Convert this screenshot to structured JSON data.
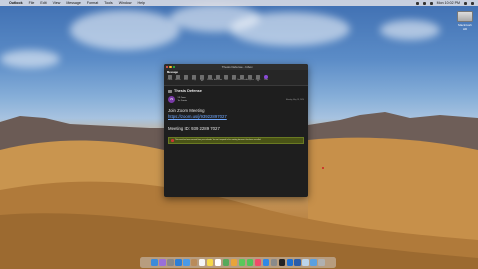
{
  "menubar": {
    "app_name": "Outlook",
    "items": [
      "File",
      "Edit",
      "View",
      "Message",
      "Format",
      "Tools",
      "Window",
      "Help"
    ],
    "clock": "Mon 10:02 PM"
  },
  "desktop": {
    "drive_label": "Macintosh HD"
  },
  "window": {
    "title": "Thesis Defense - Inbox",
    "tabs": [
      "Message"
    ],
    "ribbon": [
      {
        "label": "Delete",
        "icon": "trash-icon"
      },
      {
        "label": "Archive",
        "icon": "archive-icon"
      },
      {
        "label": "Move",
        "icon": "folder-icon"
      },
      {
        "label": "Reply",
        "icon": "reply-icon"
      },
      {
        "label": "Reply All",
        "icon": "reply-all-icon"
      },
      {
        "label": "Forward",
        "icon": "forward-icon"
      },
      {
        "label": "Attachment",
        "icon": "paperclip-icon"
      },
      {
        "label": "Junk",
        "icon": "junk-icon"
      },
      {
        "label": "Rules",
        "icon": "rules-icon"
      },
      {
        "label": "Read/Unread",
        "icon": "envelope-icon"
      },
      {
        "label": "Categorize",
        "icon": "tag-icon"
      },
      {
        "label": "Follow Up",
        "icon": "flag-icon"
      },
      {
        "label": "Zoom",
        "icon": "zoom-icon"
      }
    ],
    "subject": "Thesis Defense",
    "sender_initials": "VS",
    "sender_name": "VS Zoom",
    "sender_to": "To: Guests",
    "date": "Monday, May 18, 2020",
    "join_text": "Join Zoom Meeting",
    "join_link": "https://zoom.us/j/93922897027",
    "meeting_id": "Meeting ID: 939 2289 7027",
    "banner_text": "This event has been removed from your calendar. You can't respond to this meeting because it has been cancelled."
  },
  "dock": {
    "apps": [
      "finder-icon",
      "siri-icon",
      "launchpad-icon",
      "safari-icon",
      "mail-icon",
      "contacts-icon",
      "calendar-icon",
      "notes-icon",
      "reminders-icon",
      "maps-icon",
      "photos-icon",
      "messages-icon",
      "facetime-icon",
      "music-icon",
      "appstore-icon",
      "settings-icon",
      "terminal-icon",
      "outlook-icon",
      "word-icon",
      "preview-icon",
      "folder-icon",
      "trash-icon"
    ],
    "colors": [
      "#3d8bd9",
      "#9a6fd8",
      "#888888",
      "#2c7ed6",
      "#4a9ae8",
      "#b98b5a",
      "#f5f5f5",
      "#f6d94a",
      "#ffffff",
      "#57a95b",
      "#e8a43a",
      "#5ac85a",
      "#4fc35a",
      "#f04a6a",
      "#2f88e6",
      "#8a8a8a",
      "#222222",
      "#1e6fd0",
      "#2a5caa",
      "#bcd4ec",
      "#5aa0e0",
      "#b0b0b0"
    ]
  }
}
